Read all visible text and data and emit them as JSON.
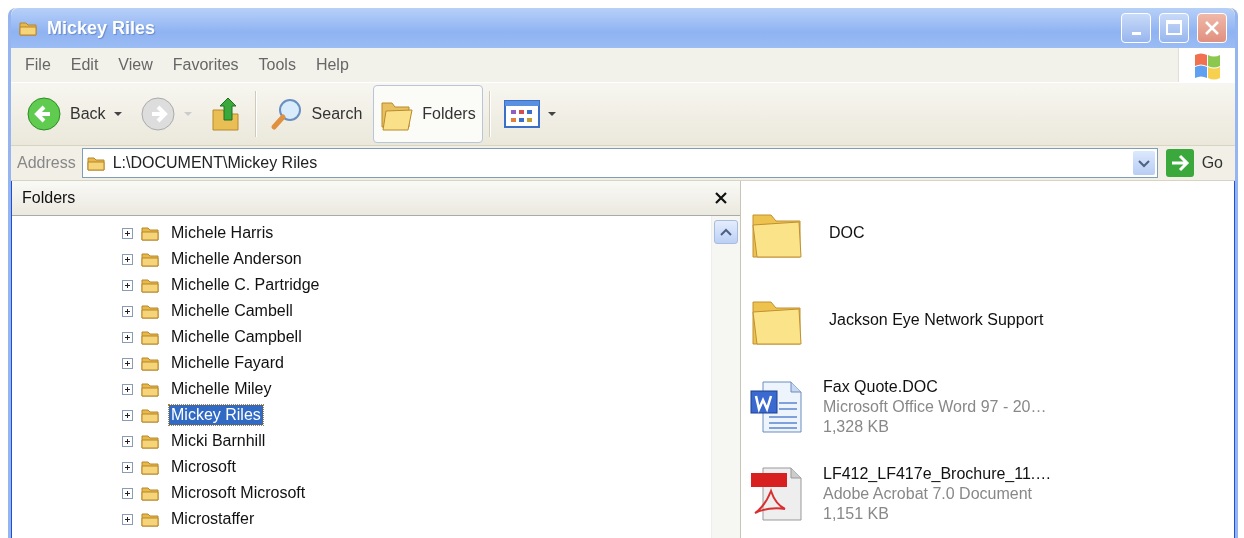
{
  "window": {
    "title": "Mickey Riles"
  },
  "menu": [
    "File",
    "Edit",
    "View",
    "Favorites",
    "Tools",
    "Help"
  ],
  "toolbar": [
    {
      "kind": "back",
      "label": "Back",
      "disabled": false
    },
    {
      "kind": "forward",
      "disabled": true
    },
    {
      "kind": "up"
    },
    {
      "kind": "search",
      "label": "Search",
      "selected": false
    },
    {
      "kind": "folders",
      "label": "Folders",
      "selected": true
    },
    {
      "kind": "views"
    }
  ],
  "address": {
    "label": "Address",
    "value": "L:\\DOCUMENT\\Mickey Riles",
    "go": "Go"
  },
  "folders_pane": {
    "title": "Folders",
    "items": [
      {
        "name": "Michele Harris",
        "expanded": false,
        "selected": false
      },
      {
        "name": "Michelle Anderson",
        "expanded": false,
        "selected": false
      },
      {
        "name": "Michelle C. Partridge",
        "expanded": false,
        "selected": false
      },
      {
        "name": "Michelle Cambell",
        "expanded": false,
        "selected": false
      },
      {
        "name": "Michelle Campbell",
        "expanded": false,
        "selected": false
      },
      {
        "name": "Michelle Fayard",
        "expanded": false,
        "selected": false
      },
      {
        "name": "Michelle Miley",
        "expanded": false,
        "selected": false
      },
      {
        "name": "Mickey Riles",
        "expanded": false,
        "selected": true
      },
      {
        "name": "Micki Barnhill",
        "expanded": false,
        "selected": false
      },
      {
        "name": "Microsoft",
        "expanded": false,
        "selected": false
      },
      {
        "name": "Microsoft Microsoft",
        "expanded": false,
        "selected": false
      },
      {
        "name": "Microstaffer",
        "expanded": false,
        "selected": false
      }
    ]
  },
  "files": [
    {
      "kind": "folder",
      "name": "DOC"
    },
    {
      "kind": "folder",
      "name": "Jackson Eye Network Support"
    },
    {
      "kind": "word",
      "name": "Fax Quote.DOC",
      "type": "Microsoft Office Word 97 - 20…",
      "size": "1,328 KB"
    },
    {
      "kind": "pdf",
      "name": "LF412_LF417e_Brochure_11.…",
      "type": "Adobe Acrobat 7.0 Document",
      "size": "1,151 KB"
    }
  ]
}
